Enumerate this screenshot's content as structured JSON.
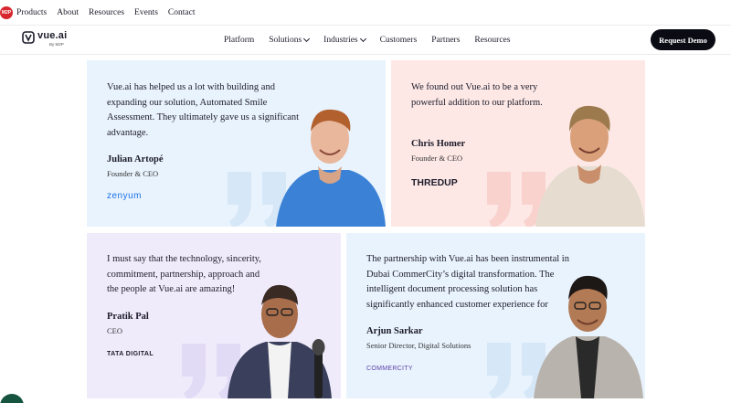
{
  "topbar": {
    "logo_text": "M2P",
    "links": [
      "Products",
      "About",
      "Resources",
      "Events",
      "Contact"
    ]
  },
  "nav": {
    "brand": "vue.ai",
    "brand_sub": "By M2P",
    "items": [
      {
        "label": "Platform",
        "dropdown": false
      },
      {
        "label": "Solutions",
        "dropdown": true
      },
      {
        "label": "Industries",
        "dropdown": true
      },
      {
        "label": "Customers",
        "dropdown": false
      },
      {
        "label": "Partners",
        "dropdown": false
      },
      {
        "label": "Resources",
        "dropdown": false
      }
    ],
    "cta": "Request Demo"
  },
  "testimonials": [
    {
      "quote": "Vue.ai has helped us a lot with building and expanding our solution, Automated Smile Assessment. They ultimately gave us a significant advantage.",
      "name": "Julian Artopé",
      "role": "Founder & CEO",
      "company_logo": "zenyum",
      "bg": "#e9f3fd"
    },
    {
      "quote": "We found out Vue.ai to be a very powerful addition to our platform.",
      "name": "Chris Homer",
      "role": "Founder & CEO",
      "company_logo": "THREDUP",
      "bg": "#fde8e6"
    },
    {
      "quote": "I must say that the technology, sincerity, commitment, partnership, approach and the people at Vue.ai are amazing!",
      "name": "Pratik Pal",
      "role": "CEO",
      "company_logo": "TATA DIGITAL",
      "bg": "#f0ebfb"
    },
    {
      "quote": "The partnership with Vue.ai has been instrumental in Dubai CommerCity’s digital transformation. The intelligent document processing solution has significantly enhanced customer experience for",
      "name": "Arjun Sarkar",
      "role": "Senior Director, Digital Solutions",
      "company_logo": "COMMERCITY",
      "bg": "#e9f3fd"
    }
  ],
  "colors": {
    "accent_dark": "#0b0b14",
    "m2p_red": "#d7262d",
    "zenyum_blue": "#1a73e8",
    "chat_green": "#17543f"
  }
}
